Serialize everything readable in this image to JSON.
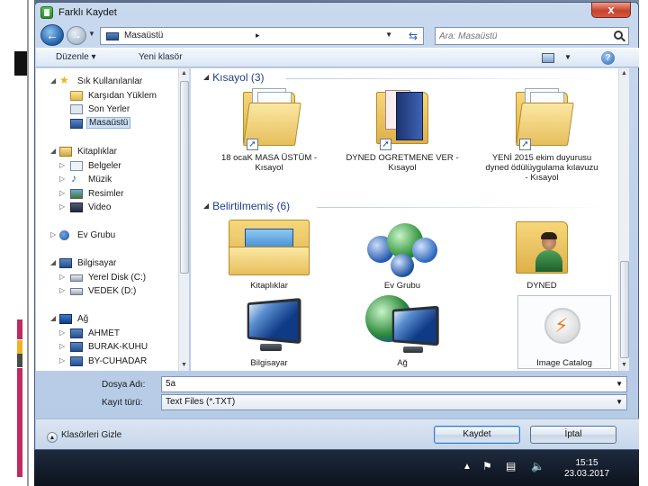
{
  "window": {
    "title": "Farklı Kaydet",
    "close_label": "x"
  },
  "address": {
    "crumb": "Masaüstü",
    "crumb_sep": "▸",
    "search_placeholder": "Ara: Masaüstü"
  },
  "toolbar": {
    "organize_label": "Düzenle ▾",
    "new_folder_label": "Yeni klasör",
    "help_label": "?"
  },
  "nav": {
    "favorites_label": "Sık Kullanılanlar",
    "downloads_label": "Karşıdan Yüklem",
    "recent_label": "Son Yerler",
    "desktop_label": "Masaüstü",
    "libraries_label": "Kitaplıklar",
    "documents_label": "Belgeler",
    "music_label": "Müzik",
    "pictures_label": "Resimler",
    "videos_label": "Video",
    "homegroup_label": "Ev Grubu",
    "computer_label": "Bilgisayar",
    "disk_c_label": "Yerel Disk (C:)",
    "disk_d_label": "VEDEK (D:)",
    "network_label": "Ağ",
    "net1_label": "AHMET",
    "net2_label": "BURAK-KUHU",
    "net3_label": "BY-CUHADAR"
  },
  "content": {
    "group1_title": "Kısayol (3)",
    "group2_title": "Belirtilmemiş (6)",
    "shortcuts": [
      "18 ocaK MASA ÜSTÜM - Kısayol",
      "DYNED OGRETMENE VER - Kısayol",
      "YENİ 2015 ekim duyurusu dyned ödülüygulama kılavuzu - Kısayol"
    ],
    "items": [
      "Kitaplıklar",
      "Ev Grubu",
      "DYNED",
      "Bilgisayar",
      "Ağ",
      "Image Catalog"
    ]
  },
  "form": {
    "filename_label": "Dosya Adı:",
    "filename_value": "5a",
    "filetype_label": "Kayıt türü:",
    "filetype_value": "Text Files (*.TXT)"
  },
  "footer": {
    "hide_folders_label": "Klasörleri Gizle",
    "save_label": "Kaydet",
    "cancel_label": "İptal"
  },
  "taskbar": {
    "time": "15:15",
    "date": "23.03.2017"
  }
}
